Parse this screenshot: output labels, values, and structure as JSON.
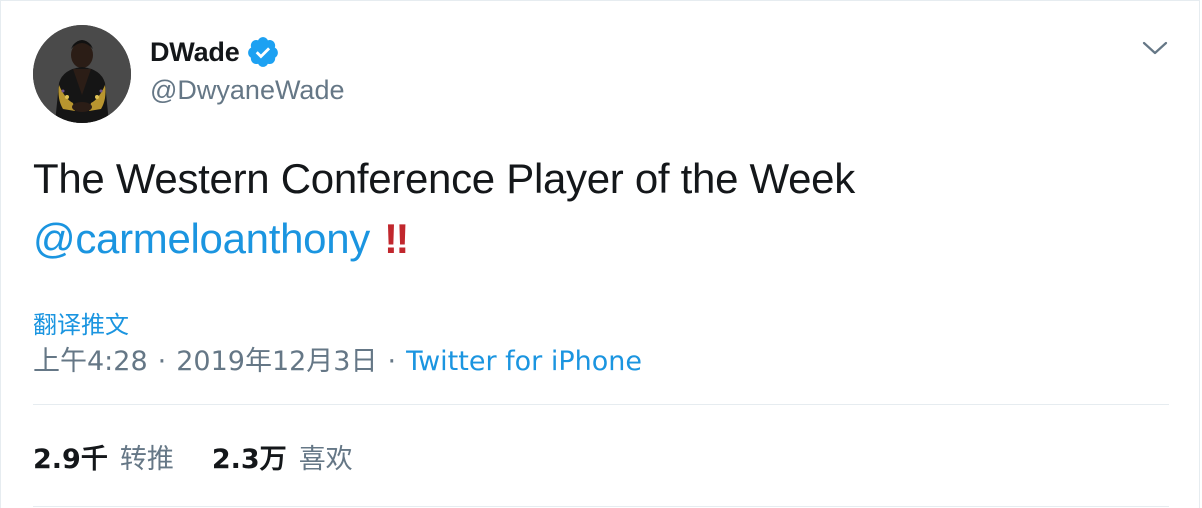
{
  "tweet": {
    "author": {
      "display_name": "DWade",
      "handle": "@DwyaneWade",
      "verified_icon": "verified-badge-icon"
    },
    "text_line1": "The Western Conference Player of the Week",
    "mention": "@carmeloanthony",
    "emphasis": "‼",
    "translate_label": "翻译推文",
    "time": "上午4:28",
    "separator": "·",
    "date": "2019年12月3日",
    "source": "Twitter for iPhone",
    "stats": {
      "retweets_count": "2.9千",
      "retweets_label": "转推",
      "likes_count": "2.3万",
      "likes_label": "喜欢"
    }
  },
  "colors": {
    "link": "#1b95e0",
    "secondary_text": "#657786",
    "primary_text": "#14171a",
    "divider": "#e6ecf0",
    "verified": "#1da1f2",
    "exclamation": "#c1272d"
  },
  "icons": {
    "menu": "chevron-down-icon",
    "verified": "verified-badge-icon"
  }
}
